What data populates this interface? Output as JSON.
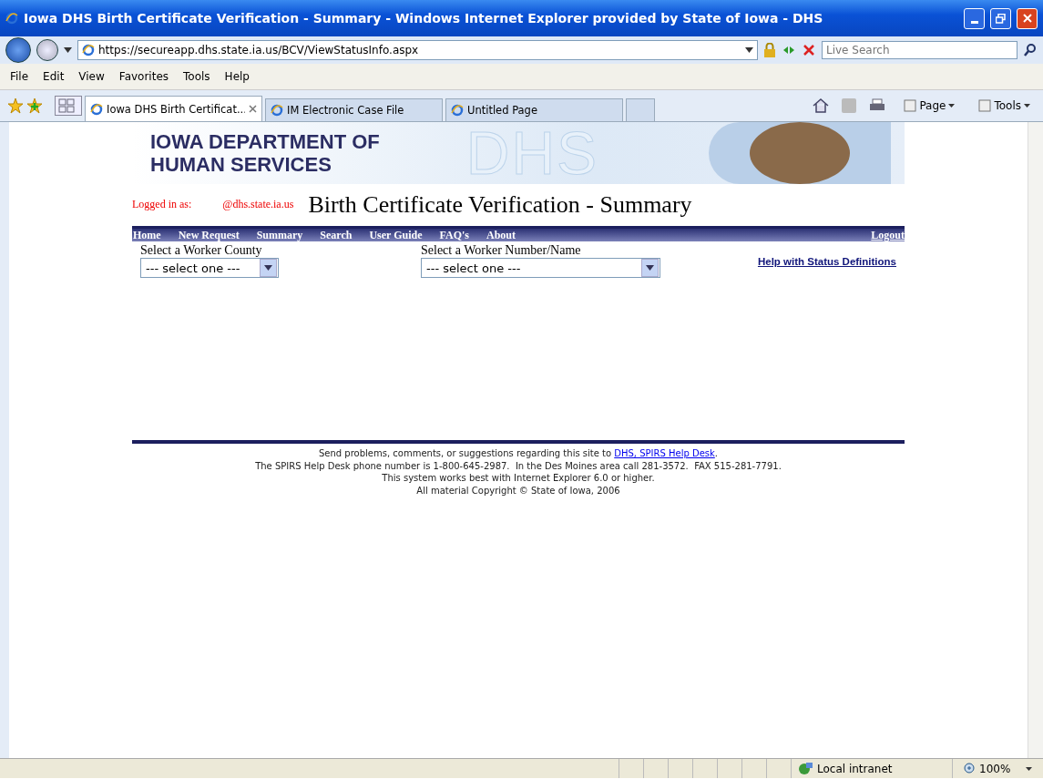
{
  "window": {
    "title": "Iowa DHS Birth Certificate Verification - Summary - Windows Internet Explorer provided by State of Iowa - DHS"
  },
  "address_bar": {
    "url": "https://secureapp.dhs.state.ia.us/BCV/ViewStatusInfo.aspx"
  },
  "search": {
    "placeholder": "Live Search"
  },
  "menu": [
    "File",
    "Edit",
    "View",
    "Favorites",
    "Tools",
    "Help"
  ],
  "tabs": [
    {
      "label": "Iowa DHS Birth Certificat...",
      "selected": true
    },
    {
      "label": "IM Electronic Case File",
      "selected": false
    },
    {
      "label": "Untitled Page",
      "selected": false
    }
  ],
  "toolbar": [
    "Page",
    "Tools"
  ],
  "page": {
    "org_lines": [
      "IOWA DEPARTMENT OF",
      "HUMAN SERVICES"
    ],
    "banner_watermark": "DHS",
    "logged_in_label": "Logged in as:",
    "logged_in_user": "@dhs.state.ia.us",
    "title": "Birth Certificate Verification - Summary",
    "nav": [
      "Home",
      "New Request",
      "Summary",
      "Search",
      "User Guide",
      "FAQ's",
      "About"
    ],
    "logout": "Logout",
    "county": {
      "label": "Select a Worker County",
      "value": "--- select one ---"
    },
    "worker": {
      "label": "Select a Worker Number/Name",
      "value": "--- select one ---"
    },
    "help_link": "Help with Status Definitions",
    "footer": {
      "line1": "Send problems, comments, or suggestions regarding this site to",
      "link": "DHS, SPIRS Help Desk",
      "line1_end": ".",
      "lines": [
        "The SPIRS Help Desk phone number is 1-800-645-2987.  In the Des Moines area call 281-3572.  FAX 515-281-7791.",
        "This system works best with Internet Explorer 6.0 or higher.",
        "All material Copyright © State of Iowa, 2006"
      ]
    }
  },
  "status_bar": {
    "zone": "Local intranet",
    "zoom": "100%"
  }
}
